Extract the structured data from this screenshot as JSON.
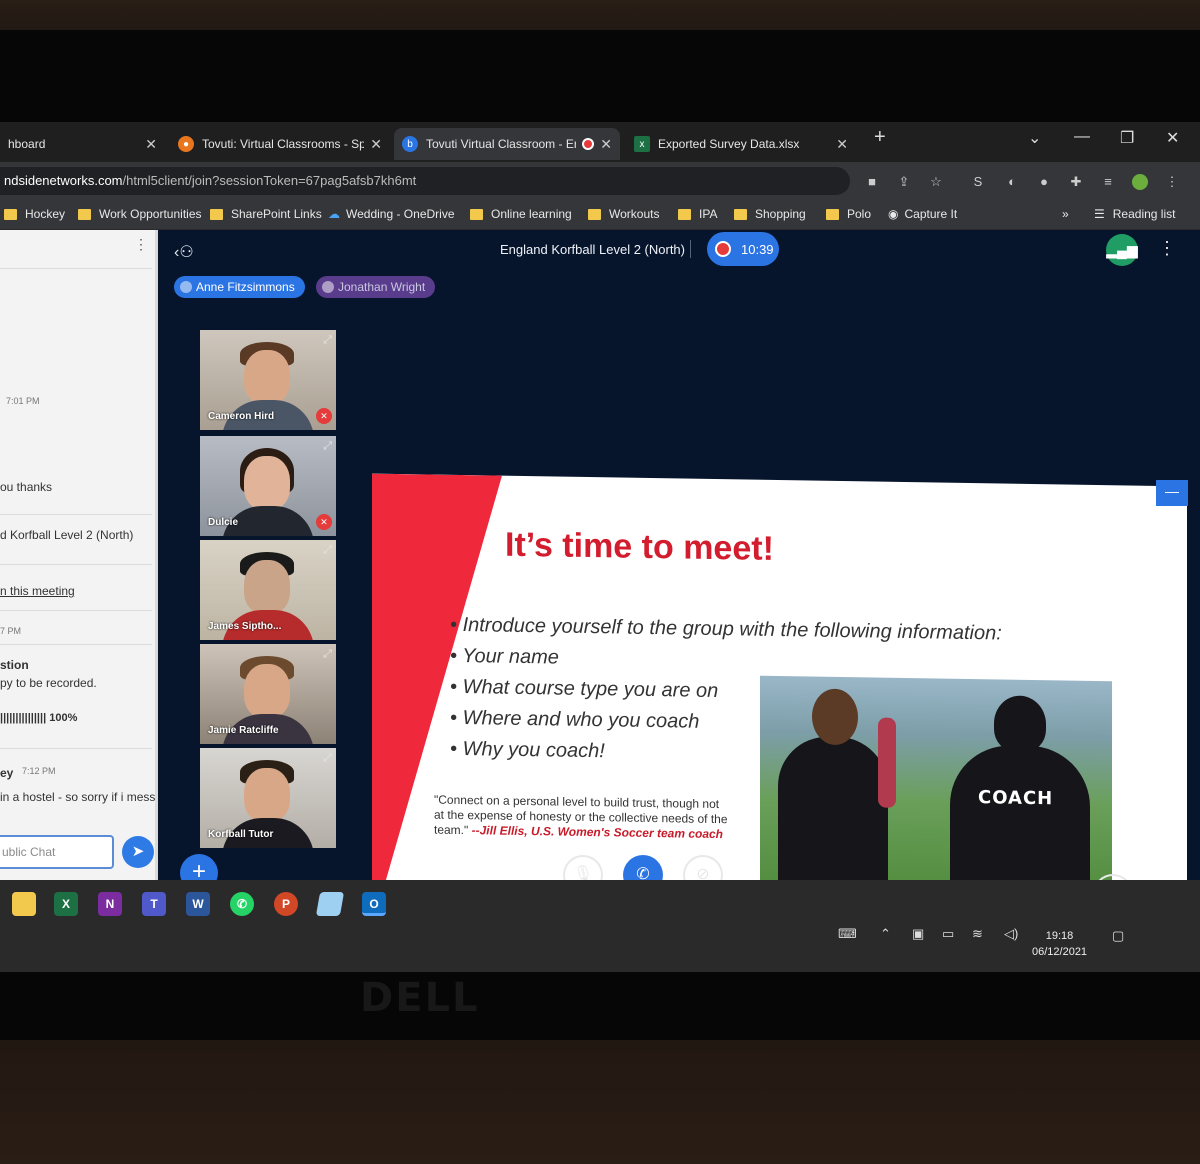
{
  "browser": {
    "tabs": [
      {
        "title": "hboard",
        "active": false
      },
      {
        "title": "Tovuti: Virtual Classrooms - Spor",
        "active": false
      },
      {
        "title": "Tovuti Virtual Classroom - En",
        "active": true
      },
      {
        "title": "Exported Survey Data.xlsx",
        "active": false
      }
    ],
    "new_tab": "+",
    "url_host": "ndsidenetworks.com",
    "url_path": "/html5client/join?sessionToken=67pag5afsb7kh6mt",
    "bookmarks": [
      "Hockey",
      "Work Opportunities",
      "SharePoint Links",
      "Wedding - OneDrive",
      "Online learning",
      "Workouts",
      "IPA",
      "Shopping",
      "Polo",
      "Capture It"
    ],
    "more": "»",
    "reading_list": "Reading list"
  },
  "meeting": {
    "title": "England Korfball Level 2 (North)",
    "recording_time": "10:39",
    "talkers": [
      "Anne Fitzsimmons",
      "Jonathan Wright"
    ],
    "participants": [
      {
        "name": "Cameron Hird"
      },
      {
        "name": "Dulcie"
      },
      {
        "name": "James Siptho..."
      },
      {
        "name": "Jamie Ratcliffe"
      },
      {
        "name": "Korfball Tutor"
      }
    ]
  },
  "chat": {
    "times": [
      "7:01 PM",
      "7 PM",
      "7:12 PM"
    ],
    "lines": [
      "ou thanks",
      "d Korfball Level 2 (North)",
      "n this meeting",
      "stion",
      "py to be recorded.",
      "||||||||||||||| 100%",
      "ey",
      "in a hostel - so sorry if i mess"
    ],
    "placeholder": "ublic Chat"
  },
  "slide": {
    "title": "It’s time to meet!",
    "bullets": [
      "Introduce yourself to the group with the following information:",
      "Your name",
      "What course type you are on",
      "Where and who you coach",
      "Why you coach!"
    ],
    "quote": "\"Connect on a personal level to build trust, though not at the expense of honesty or the collective needs of the team.\"",
    "quote_author": "--Jill Ellis, U.S. Women's Soccer team coach",
    "photo_text": "COACH"
  },
  "taskbar": {
    "time": "19:18",
    "date": "06/12/2021"
  },
  "colors": {
    "accent": "#2b74e3",
    "slide_red": "#f0283b",
    "meeting_bg": "#07152c"
  }
}
